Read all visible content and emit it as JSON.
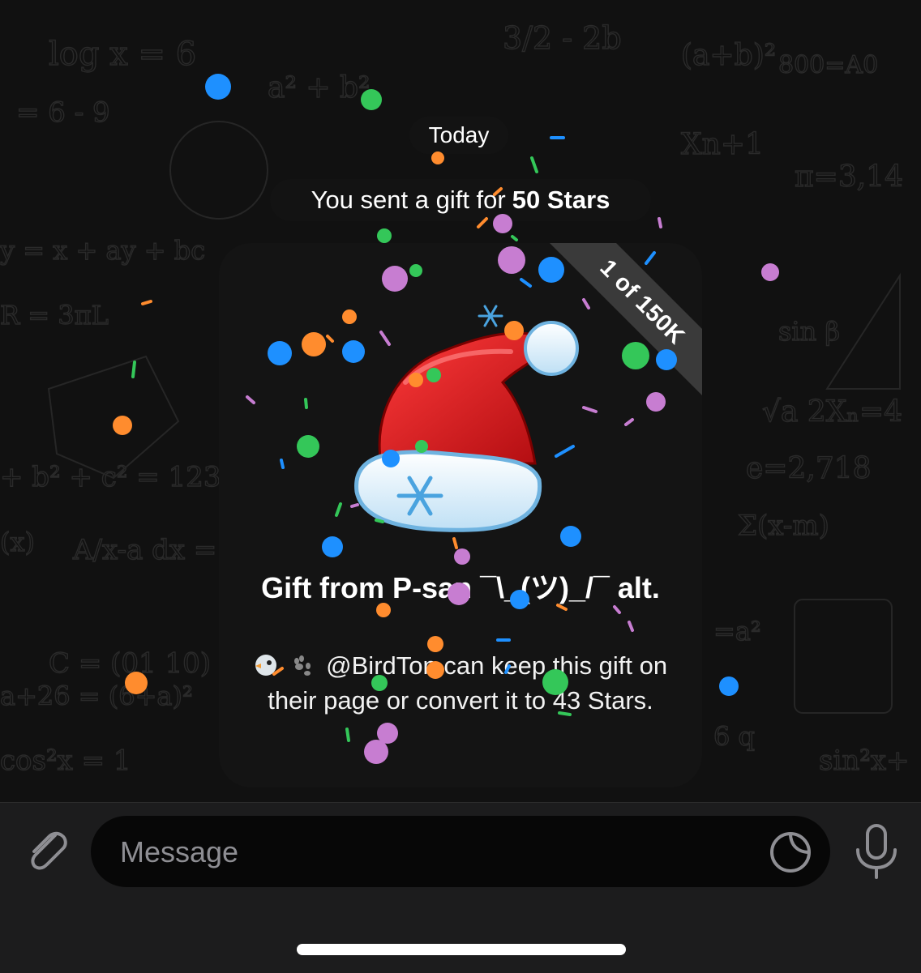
{
  "date_divider": "Today",
  "service_message": {
    "prefix": "You sent a gift for",
    "amount": "50 Stars"
  },
  "gift": {
    "ribbon": "1 of 150K",
    "image": "santa-hat",
    "title": "Gift from P-san ¯\\_(ツ)_/¯ alt.",
    "description": "@BirdTon can keep this gift on their page or convert it to 43 Stars.",
    "emoji_prefix": [
      "bird-emoji",
      "paw-prints-emoji"
    ]
  },
  "composer": {
    "placeholder": "Message",
    "icons": [
      "paperclip-icon",
      "sticker-icon",
      "microphone-icon"
    ]
  },
  "colors": {
    "confetti_blue": "#1e90ff",
    "confetti_green": "#34c759",
    "confetti_orange": "#ff8c2e",
    "confetti_purple": "#c77dd1",
    "hat_red": "#e3171b"
  }
}
